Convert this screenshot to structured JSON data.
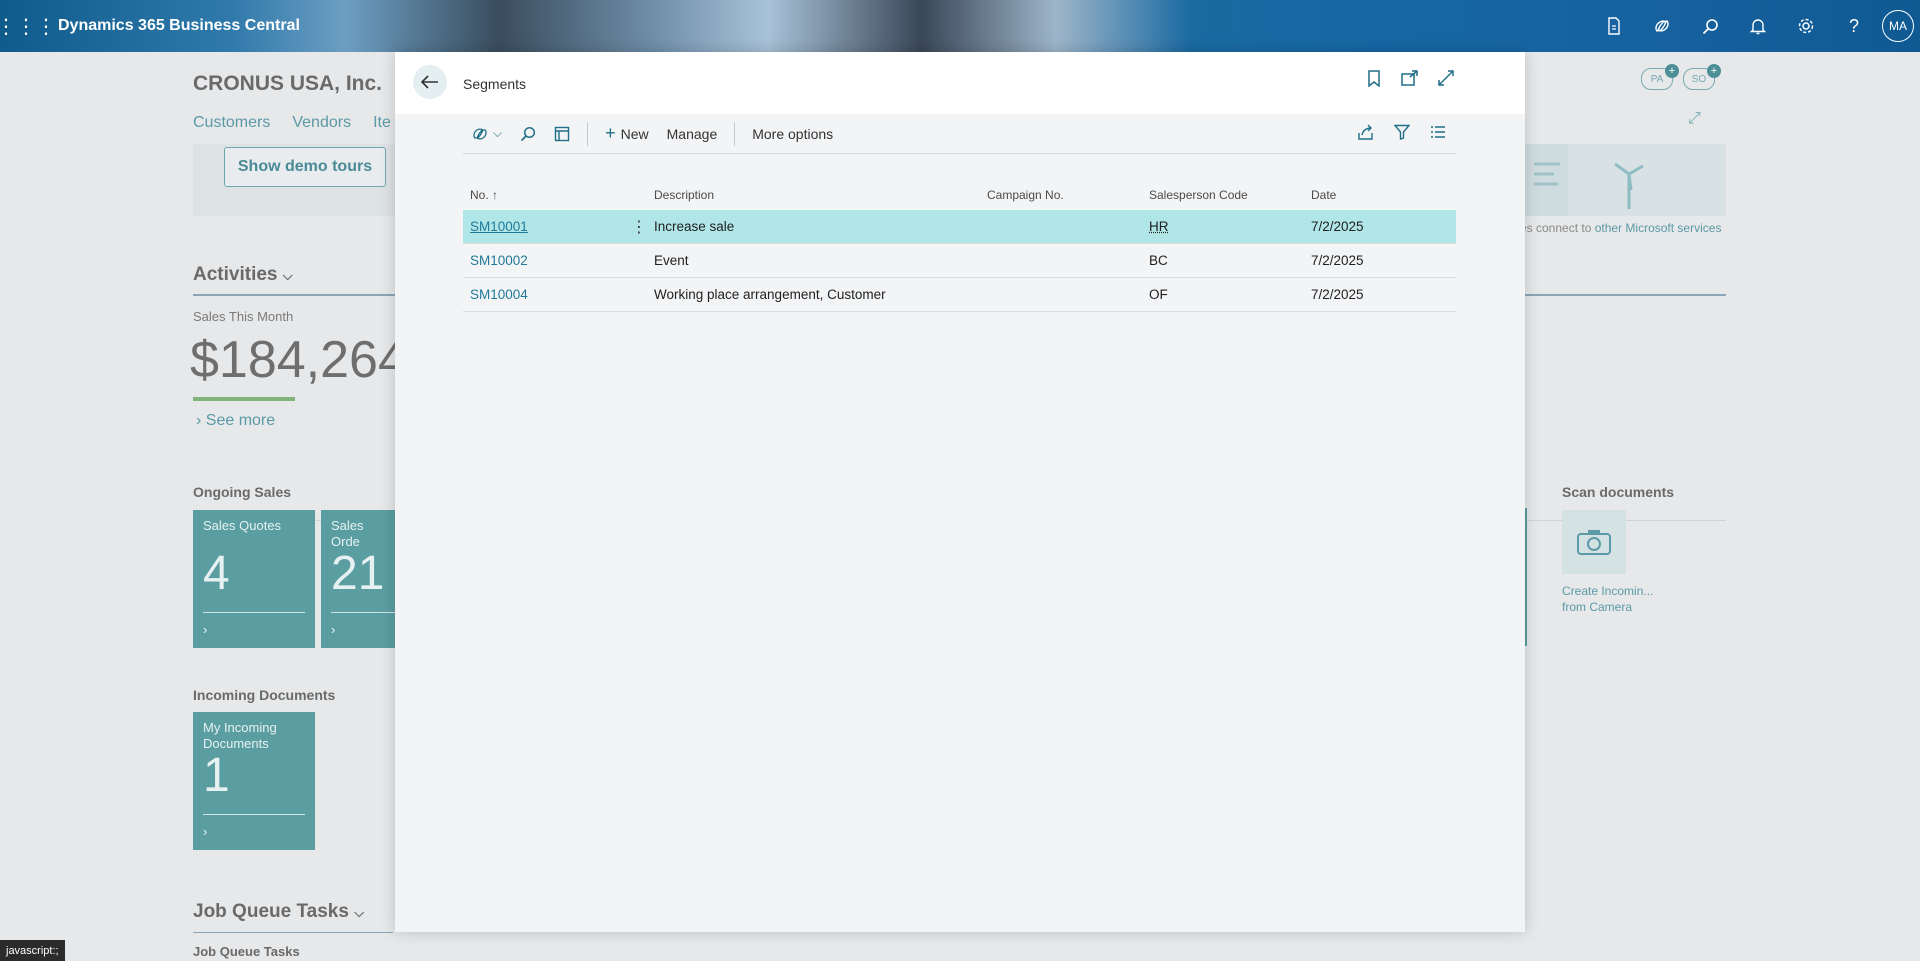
{
  "app": {
    "brand": "Dynamics 365 Business Central",
    "user_initials": "MA"
  },
  "topbar_icons": [
    "document-icon",
    "copilot-icon",
    "search-icon",
    "bell-icon",
    "gear-icon",
    "help-icon"
  ],
  "background": {
    "company": "CRONUS USA, Inc.",
    "nav": [
      "Customers",
      "Vendors",
      "Ite"
    ],
    "demo_button": "Show demo tours",
    "connect_text": "es connect to",
    "connect_link": "other Microsoft services",
    "activities_title": "Activities",
    "sales_this_month_label": "Sales This Month",
    "sales_this_month_value": "$184,264",
    "see_more": "See more",
    "ongoing_sales_title": "Ongoing Sales",
    "tiles": [
      {
        "label": "Sales Quotes",
        "value": "4"
      },
      {
        "label": "Sales Orde",
        "value": "21"
      }
    ],
    "incoming_docs_title": "Incoming Documents",
    "incoming_tile": {
      "label": "My Incoming Documents",
      "value": "1"
    },
    "scan_title": "Scan documents",
    "scan_link": "Create Incomin... from Camera",
    "job_queue_title": "Job Queue Tasks",
    "job_queue_sub": "Job Queue Tasks",
    "pill_pa": "PA",
    "pill_so": "SO"
  },
  "modal": {
    "title": "Segments",
    "toolbar": {
      "new_label": "New",
      "manage_label": "Manage",
      "more_label": "More options"
    },
    "columns": [
      "No. ↑",
      "Description",
      "Campaign No.",
      "Salesperson Code",
      "Date"
    ],
    "rows": [
      {
        "no": "SM10001",
        "description": "Increase sale",
        "campaign": "",
        "salesperson": "HR",
        "date": "7/2/2025"
      },
      {
        "no": "SM10002",
        "description": "Event",
        "campaign": "",
        "salesperson": "BC",
        "date": "7/2/2025"
      },
      {
        "no": "SM10004",
        "description": "Working place arrangement, Customer",
        "campaign": "",
        "salesperson": "OF",
        "date": "7/2/2025"
      }
    ]
  },
  "status_bar": "javascript:;"
}
